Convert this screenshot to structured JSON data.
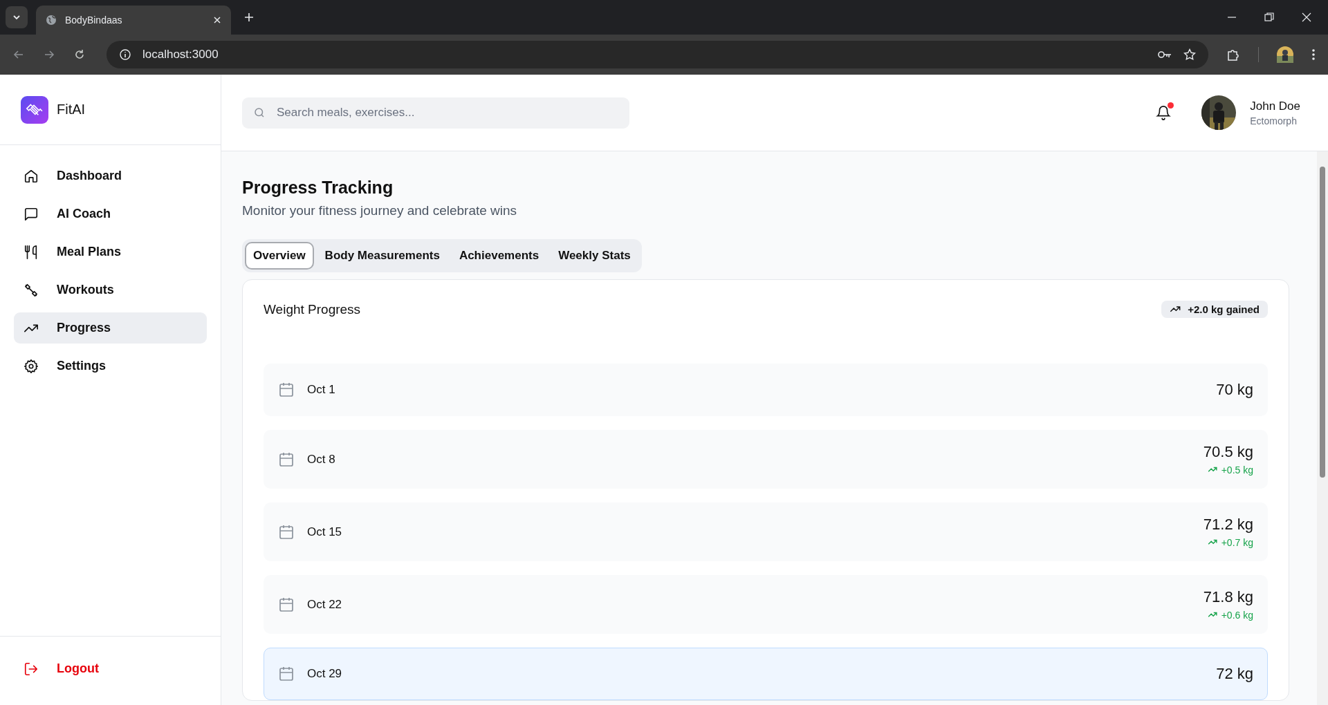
{
  "browser": {
    "tab_title": "BodyBindaas",
    "url": "localhost:3000"
  },
  "sidebar": {
    "brand": "FitAI",
    "items": [
      {
        "label": "Dashboard",
        "kind": "home",
        "selected": false
      },
      {
        "label": "AI Coach",
        "kind": "chat",
        "selected": false
      },
      {
        "label": "Meal Plans",
        "kind": "utensils",
        "selected": false
      },
      {
        "label": "Workouts",
        "kind": "dumbbell",
        "selected": false
      },
      {
        "label": "Progress",
        "kind": "trend",
        "selected": true
      },
      {
        "label": "Settings",
        "kind": "gear",
        "selected": false
      }
    ],
    "logout": "Logout"
  },
  "header": {
    "search": {
      "placeholder": "Search meals, exercises..."
    },
    "notification_dot": true,
    "user": {
      "name": "John Doe",
      "subtitle": "Ectomorph"
    }
  },
  "page": {
    "title": "Progress Tracking",
    "subtitle": "Monitor your fitness journey and celebrate wins",
    "tabs": [
      {
        "label": "Overview",
        "selected": true
      },
      {
        "label": "Body Measurements",
        "selected": false
      },
      {
        "label": "Achievements",
        "selected": false
      },
      {
        "label": "Weekly Stats",
        "selected": false
      }
    ],
    "card": {
      "title": "Weight Progress",
      "badge": "+2.0 kg gained",
      "entries": [
        {
          "date": "Oct 1",
          "weight": "70 kg",
          "selected": false
        },
        {
          "date": "Oct 8",
          "weight": "70.5 kg",
          "change": "+0.5 kg",
          "selected": false
        },
        {
          "date": "Oct 15",
          "weight": "71.2 kg",
          "change": "+0.7 kg",
          "selected": false
        },
        {
          "date": "Oct 22",
          "weight": "71.8 kg",
          "change": "+0.6 kg",
          "selected": false
        },
        {
          "date": "Oct 29",
          "weight": "72 kg",
          "selected": true
        }
      ]
    }
  }
}
